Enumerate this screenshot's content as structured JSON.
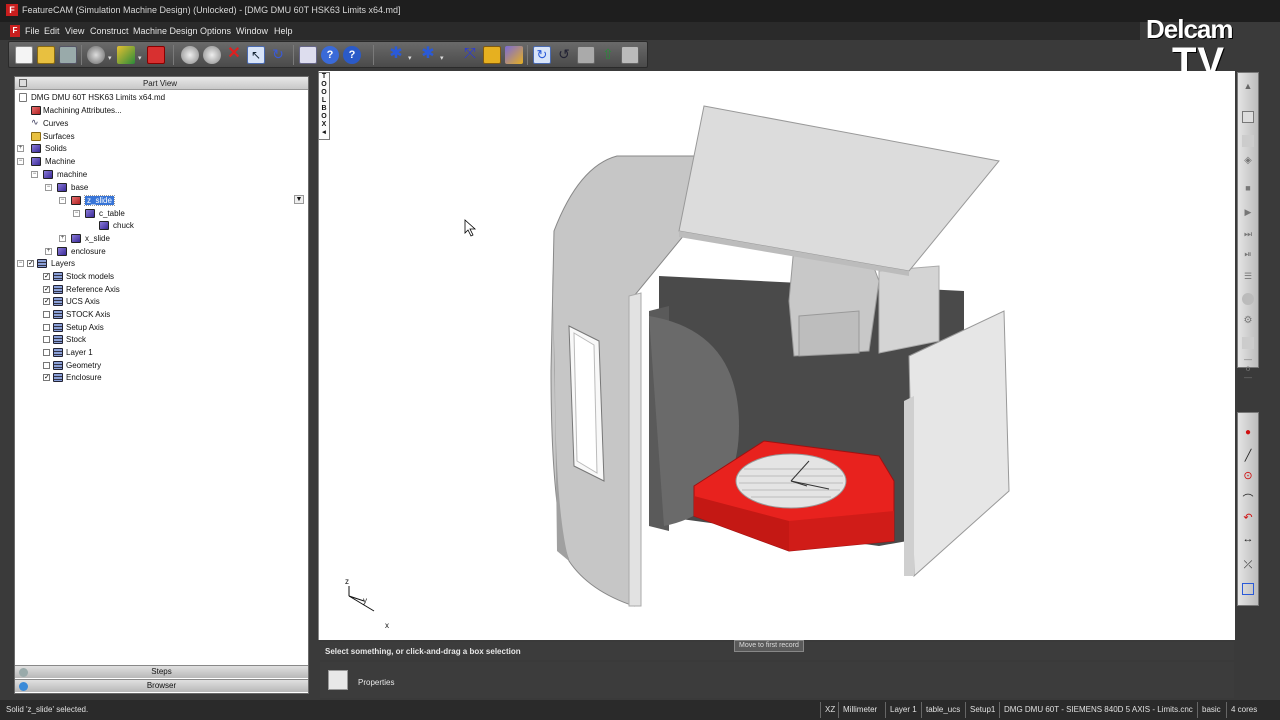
{
  "window": {
    "title": "FeatureCAM (Simulation Machine Design) (Unlocked) - [DMG DMU 60T HSK63 Limits x64.md]"
  },
  "menu": [
    "File",
    "Edit",
    "View",
    "Construct",
    "Machine Design",
    "Options",
    "Window",
    "Help"
  ],
  "brand": {
    "line1": "Delcam",
    "line2": "TV"
  },
  "part_view": {
    "header": "Part View",
    "tree": [
      {
        "label": "DMG DMU 60T HSK63 Limits x64.md",
        "icon": "document-icon"
      },
      {
        "label": "Machining Attributes...",
        "icon": "machining-attributes-icon"
      },
      {
        "label": "Curves",
        "icon": "curve-icon"
      },
      {
        "label": "Surfaces",
        "icon": "surface-icon"
      },
      {
        "label": "Solids",
        "icon": "solid-icon"
      },
      {
        "label": "Machine",
        "icon": "solid-icon"
      },
      {
        "label": "machine",
        "icon": "solid-icon"
      },
      {
        "label": "base",
        "icon": "solid-icon"
      },
      {
        "label": "z_slide",
        "icon": "solid-icon",
        "selected": true
      },
      {
        "label": "c_table",
        "icon": "solid-icon"
      },
      {
        "label": "chuck",
        "icon": "solid-icon"
      },
      {
        "label": "x_slide",
        "icon": "solid-icon"
      },
      {
        "label": "enclosure",
        "icon": "solid-icon"
      },
      {
        "label": "Layers",
        "icon": "layers-icon"
      },
      {
        "label": "Stock models",
        "icon": "layers-icon",
        "checked": true
      },
      {
        "label": "Reference Axis",
        "icon": "layers-icon",
        "checked": true
      },
      {
        "label": "UCS Axis",
        "icon": "layers-icon",
        "checked": true
      },
      {
        "label": "STOCK Axis",
        "icon": "layers-icon",
        "checked": false
      },
      {
        "label": "Setup Axis",
        "icon": "layers-icon",
        "checked": false
      },
      {
        "label": "Stock",
        "icon": "layers-icon",
        "checked": false
      },
      {
        "label": "Layer 1",
        "icon": "layers-icon",
        "checked": false
      },
      {
        "label": "Geometry",
        "icon": "layers-icon",
        "checked": false
      },
      {
        "label": "Enclosure",
        "icon": "layers-icon",
        "checked": true
      }
    ]
  },
  "left_tabs": {
    "steps": "Steps",
    "browser": "Browser"
  },
  "toolbox": {
    "label": "TOOLBOX"
  },
  "axis_triad": {
    "z": "z",
    "y": "y",
    "x": "x"
  },
  "prompt": {
    "text": "Select something, or click-and-drag a box selection",
    "tooltip": "Move to first record"
  },
  "properties": {
    "label": "Properties"
  },
  "status": {
    "message": "Solid 'z_slide' selected.",
    "cells": [
      "XZ",
      "Millimeter",
      "Layer 1",
      "table_ucs",
      "Setup1",
      "DMG DMU 60T - SIEMENS 840D 5 AXIS - Limits.cnc",
      "basic",
      "4 cores"
    ]
  },
  "colors": {
    "accent": "#e51c1c",
    "selection": "#3875d7",
    "chrome": "#2a2a2a"
  }
}
